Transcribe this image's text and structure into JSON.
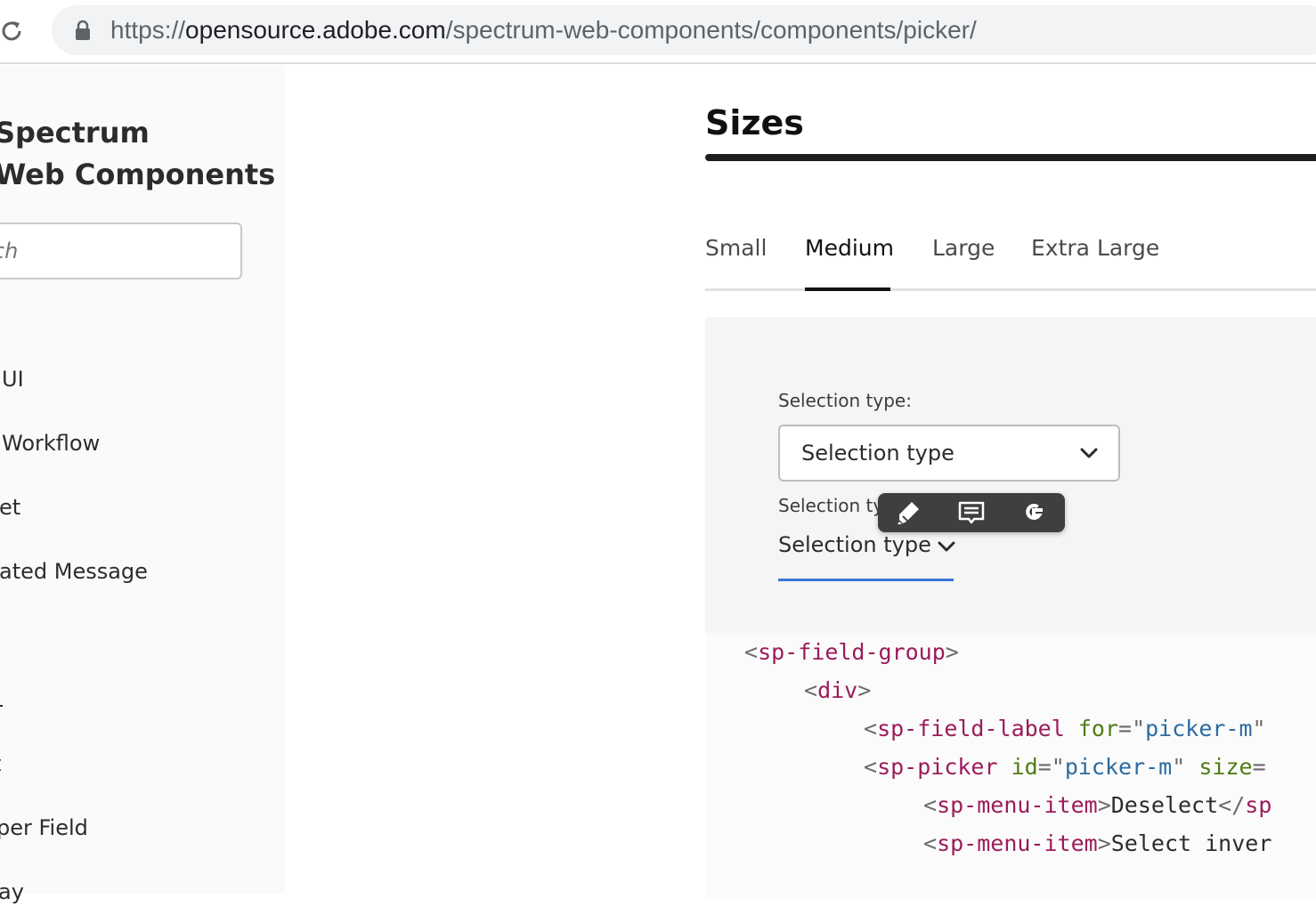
{
  "browser": {
    "url_scheme": "https://",
    "url_host": "opensource.adobe.com",
    "url_path": "/spectrum-web-components/components/picker/"
  },
  "sidebar": {
    "brand_line1": "Spectrum",
    "brand_line2": "Web Components",
    "search_value": "rch",
    "items": [
      {
        "label": "UI"
      },
      {
        "label": "Workflow"
      },
      {
        "label": "et"
      },
      {
        "label": "ated Message"
      },
      {
        "label": "1"
      },
      {
        "label": "t"
      },
      {
        "label": "per Field"
      },
      {
        "label": "ay"
      }
    ]
  },
  "main": {
    "heading": "Sizes",
    "tabs": [
      {
        "label": "Small",
        "selected": false
      },
      {
        "label": "Medium",
        "selected": true
      },
      {
        "label": "Large",
        "selected": false
      },
      {
        "label": "Extra Large",
        "selected": false
      }
    ],
    "demo": {
      "label_1": "Selection type:",
      "picker_1_value": "Selection type",
      "label_2": "Selection type:",
      "picker_2_value": "Selection type"
    },
    "code": {
      "lt": "<",
      "gt": ">",
      "close_lt": "</",
      "tag_field_group": "sp-field-group",
      "tag_div": "div",
      "tag_field_label": "sp-field-label",
      "attr_for": "for",
      "eq": "=",
      "quote": "\"",
      "val_picker_m": "picker-m",
      "tag_picker": "sp-picker",
      "attr_id": "id",
      "attr_size": "size",
      "tag_menu_item": "sp-menu-item",
      "text_deselect": "Deselect",
      "text_select_inver": "Select inver",
      "close_partial": "sp"
    }
  },
  "popup": {
    "icons": [
      "highlighter-icon",
      "comment-icon",
      "google-icon"
    ]
  },
  "colors": {
    "accent_underline": "#3b78d8",
    "code_tag": "#9b1c5a",
    "code_attr": "#4f7d15",
    "code_string": "#2c6ba0"
  }
}
